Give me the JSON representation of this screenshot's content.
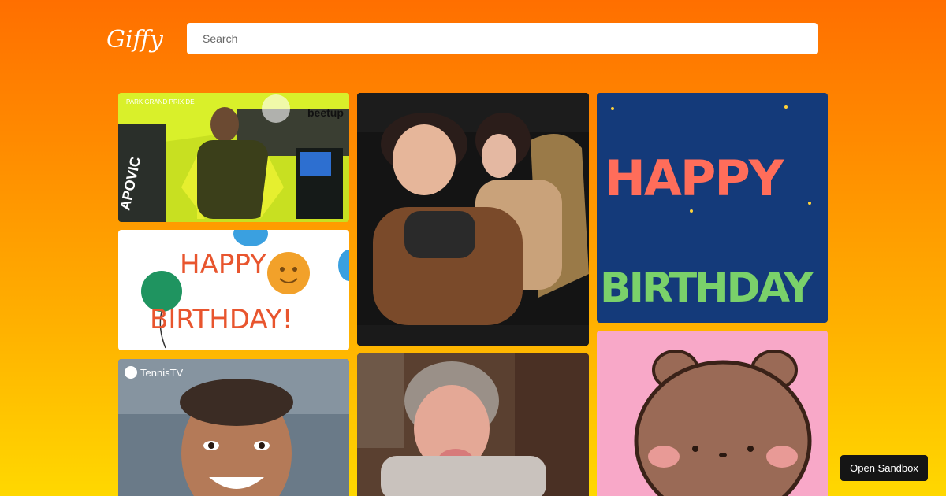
{
  "app": {
    "logo_text": "Giffy",
    "search": {
      "placeholder": "Search",
      "value": ""
    }
  },
  "gifs": [
    {
      "id": "motogp-rider",
      "overlay_text": "PARK GRAND PRIX DE",
      "name_text": "APOVIC",
      "brand_text": "beetup"
    },
    {
      "id": "happy-birthday-balloons",
      "line1": "HAPPY",
      "line2": "BIRTHDAY!"
    },
    {
      "id": "tennis-tv-player",
      "watermark": "TennisTV"
    },
    {
      "id": "dancing-women"
    },
    {
      "id": "grandma-birthday-cake"
    },
    {
      "id": "happy-birthday-bubble-letters",
      "line1": "HAPPY",
      "line2": "BIRTHDAY"
    },
    {
      "id": "cute-bear-pink"
    }
  ],
  "footer": {
    "sandbox_label": "Open Sandbox"
  },
  "colors": {
    "gradient_top": "#ff6f00",
    "gradient_bottom": "#ffd800",
    "sandbox_button": "#151515"
  }
}
